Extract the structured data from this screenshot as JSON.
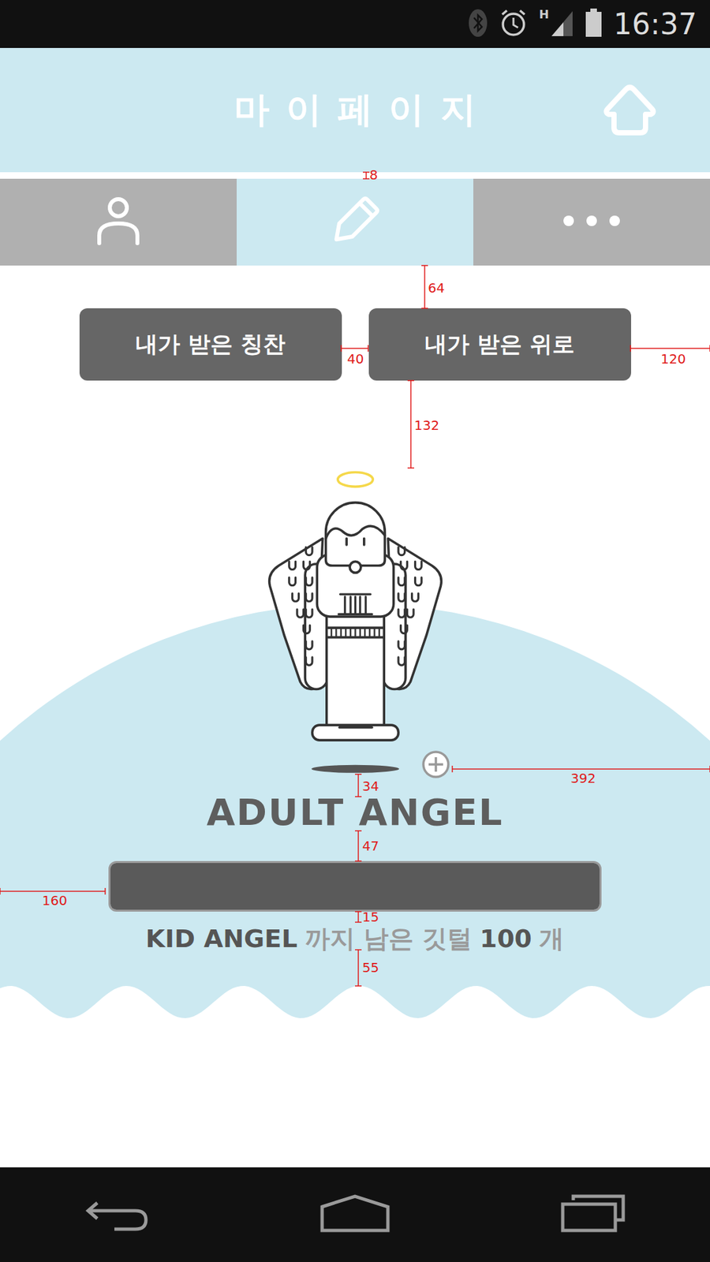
{
  "status_bar": {
    "network": "H",
    "time": "16:37"
  },
  "header": {
    "title": "마이페이지"
  },
  "tabs": [
    {
      "selected": false
    },
    {
      "selected": true
    },
    {
      "selected": false
    }
  ],
  "buttons": [
    {
      "label": "내가 받은 칭찬"
    },
    {
      "label": "내가 받은 위로"
    }
  ],
  "character": {
    "title": "ADULT ANGEL"
  },
  "progress": {
    "level": 1
  },
  "caption": [
    {
      "text": "KID ANGEL",
      "emphasis": true
    },
    {
      "text": "까지 남은 깃털",
      "emphasis": false
    },
    {
      "text": "100",
      "emphasis": true
    },
    {
      "text": "개",
      "emphasis": false
    }
  ],
  "annotations": [
    "8",
    "64",
    "40",
    "120",
    "132",
    "34",
    "392",
    "47",
    "160",
    "15",
    "55"
  ]
}
